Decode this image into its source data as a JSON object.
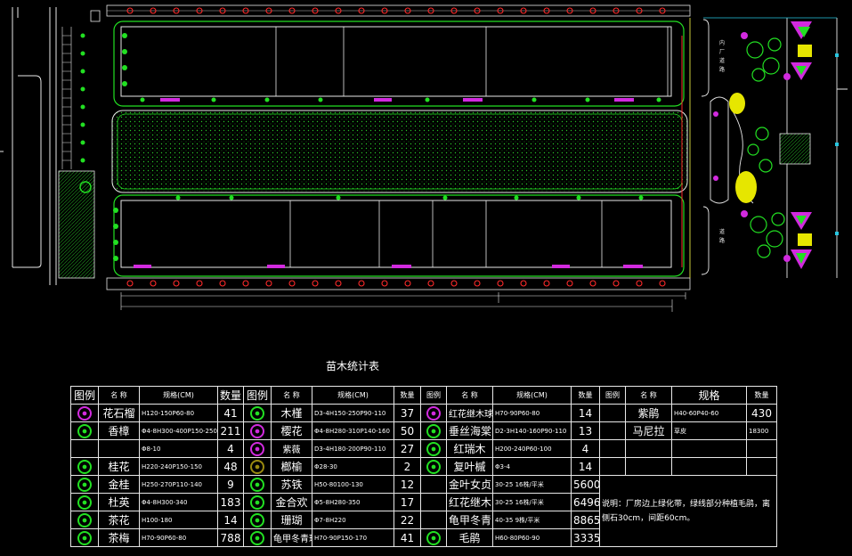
{
  "drawing": {
    "road_labels": [
      "内",
      "厂",
      "道",
      "路",
      "道",
      "路"
    ],
    "colors": {
      "background": "#000000",
      "line_white": "#e8e8e8",
      "line_yellow": "#ffff4a",
      "green": "#22e022",
      "magenta": "#d22adf",
      "red": "#ff2a2a",
      "cyan": "#26c6e0",
      "dim_gray": "#9a9a9a"
    }
  },
  "table": {
    "title": "苗木统计表",
    "headers": [
      {
        "text": "图例",
        "cls": "h"
      },
      {
        "text": "名 称",
        "cls": "hs"
      },
      {
        "text": "规格(CM)",
        "cls": "hs"
      },
      {
        "text": "数量",
        "cls": "h"
      },
      {
        "text": "图例",
        "cls": "h"
      },
      {
        "text": "名 称",
        "cls": "hs"
      },
      {
        "text": "规格(CM)",
        "cls": "hs"
      },
      {
        "text": "数量",
        "cls": "hs"
      },
      {
        "text": "图例",
        "cls": "hs"
      },
      {
        "text": "名 称",
        "cls": "hs"
      },
      {
        "text": "规格(CM)",
        "cls": "hs"
      },
      {
        "text": "数量",
        "cls": "hs"
      },
      {
        "text": "图例",
        "cls": "hs"
      },
      {
        "text": "名 称",
        "cls": "hs"
      },
      {
        "text": "规格",
        "cls": "h"
      },
      {
        "text": "数量",
        "cls": "hs"
      }
    ],
    "rows": [
      [
        {
          "sym": "#d22adf"
        },
        {
          "t": "花石榴"
        },
        {
          "t": "H120-150P60-80",
          "sp": 1
        },
        {
          "t": "41"
        },
        {
          "sym": "#22e022"
        },
        {
          "t": "木槿"
        },
        {
          "t": "D3-4H150-250P90-110",
          "sp": 1
        },
        {
          "t": "37"
        },
        {
          "sym": "#d22adf"
        },
        {
          "t": "红花继木球",
          "s": 1
        },
        {
          "t": "H70-90P60-80",
          "sp": 1
        },
        {
          "t": "14"
        },
        {
          "t": ""
        },
        {
          "t": "紫鹃"
        },
        {
          "t": "H40-60P40-60",
          "sp": 1
        },
        {
          "t": "430"
        }
      ],
      [
        {
          "sym": "#22e022"
        },
        {
          "t": "香樟"
        },
        {
          "t": "Φ4-8H300-400P150-250",
          "sp": 1
        },
        {
          "t": "211"
        },
        {
          "sym": "#d22adf"
        },
        {
          "t": "樱花"
        },
        {
          "t": "Φ4-8H280-310P140-160",
          "sp": 1
        },
        {
          "t": "50"
        },
        {
          "sym": "#22e022"
        },
        {
          "t": "垂丝海棠"
        },
        {
          "t": "D2-3H140-160P90-110",
          "sp": 1
        },
        {
          "t": "13"
        },
        {
          "t": ""
        },
        {
          "t": "马尼拉"
        },
        {
          "t": "草皮",
          "sp": 1
        },
        {
          "t": "18300",
          "sp": 1
        }
      ],
      [
        {
          "t": ""
        },
        {
          "t": ""
        },
        {
          "t": "Φ8-10",
          "sp": 1
        },
        {
          "t": "4"
        },
        {
          "sym": "#d22adf"
        },
        {
          "t": "紫薇",
          "s": 1
        },
        {
          "t": "D3-4H180-200P90-110",
          "sp": 1
        },
        {
          "t": "27"
        },
        {
          "sym": "#22e022"
        },
        {
          "t": "红瑞木"
        },
        {
          "t": "H200-240P60-100",
          "sp": 1
        },
        {
          "t": "4"
        },
        {
          "t": ""
        },
        {
          "t": ""
        },
        {
          "t": ""
        },
        {
          "t": ""
        }
      ],
      [
        {
          "sym": "#22e022"
        },
        {
          "t": "桂花"
        },
        {
          "t": "H220-240P150-150",
          "sp": 1
        },
        {
          "t": "48"
        },
        {
          "sym": "#9a8a10"
        },
        {
          "t": "榔榆"
        },
        {
          "t": "Φ28-30",
          "sp": 1
        },
        {
          "t": "2"
        },
        {
          "sym": "#22e022"
        },
        {
          "t": "复叶槭"
        },
        {
          "t": "Φ3-4",
          "sp": 1
        },
        {
          "t": "14"
        },
        {
          "t": ""
        },
        {
          "t": ""
        },
        {
          "t": ""
        },
        {
          "t": ""
        }
      ],
      [
        {
          "sym": "#22e022"
        },
        {
          "t": "金桂"
        },
        {
          "t": "H250-270P110-140",
          "sp": 1
        },
        {
          "t": "9"
        },
        {
          "sym": "#22e022"
        },
        {
          "t": "苏铁"
        },
        {
          "t": "H50-80100-130",
          "sp": 1
        },
        {
          "t": "12"
        },
        {
          "t": ""
        },
        {
          "t": "金叶女贞"
        },
        {
          "t": "30-25   16株/平米",
          "sp": 1
        },
        {
          "t": "5600"
        },
        {
          "note": 1
        },
        {},
        {},
        {}
      ],
      [
        {
          "sym": "#22e022"
        },
        {
          "t": "杜英"
        },
        {
          "t": "Φ4-8H300-340",
          "sp": 1
        },
        {
          "t": "183"
        },
        {
          "sym": "#22e022"
        },
        {
          "t": "金合欢"
        },
        {
          "t": "Φ5-8H280-350",
          "sp": 1
        },
        {
          "t": "17"
        },
        {
          "t": ""
        },
        {
          "t": "红花继木"
        },
        {
          "t": "30-25   16株/平米",
          "sp": 1
        },
        {
          "t": "6496"
        },
        {},
        {},
        {},
        {}
      ],
      [
        {
          "sym": "#22e022"
        },
        {
          "t": "茶花"
        },
        {
          "t": "H100-180",
          "sp": 1
        },
        {
          "t": "14"
        },
        {
          "sym": "#22e022"
        },
        {
          "t": "珊瑚"
        },
        {
          "t": "Φ7-8H220",
          "sp": 1
        },
        {
          "t": "22"
        },
        {
          "t": ""
        },
        {
          "t": "龟甲冬青"
        },
        {
          "t": "40-35   9株/平米",
          "sp": 1
        },
        {
          "t": "8865"
        },
        {},
        {},
        {},
        {}
      ],
      [
        {
          "sym": "#22e022"
        },
        {
          "t": "茶梅"
        },
        {
          "t": "H70-90P60-80",
          "sp": 1
        },
        {
          "t": "788"
        },
        {
          "sym": "#22e022"
        },
        {
          "t": "龟甲冬青球",
          "s": 1
        },
        {
          "t": "H70-90P150-170",
          "sp": 1
        },
        {
          "t": "41"
        },
        {
          "sym": "#22e022"
        },
        {
          "t": "毛鹃"
        },
        {
          "t": "H60-80P60-90",
          "sp": 1
        },
        {
          "t": "3335"
        },
        {},
        {},
        {},
        {}
      ]
    ],
    "note": "说明：厂房边上绿化带，绿线部分种植毛鹃，离侧石30cm，间距60cm。"
  }
}
